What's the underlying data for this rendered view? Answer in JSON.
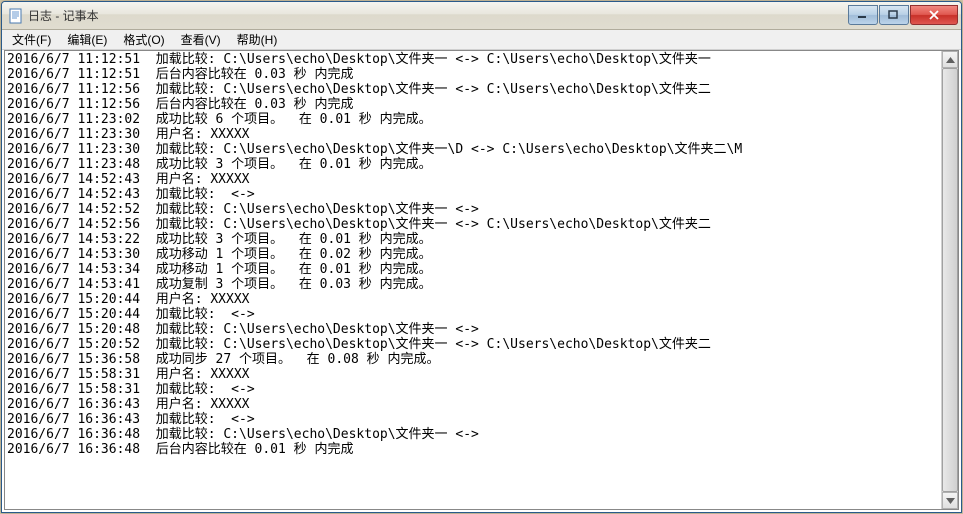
{
  "window": {
    "title": "日志 - 记事本"
  },
  "menu": {
    "file": "文件(F)",
    "edit": "编辑(E)",
    "format": "格式(O)",
    "view": "查看(V)",
    "help": "帮助(H)"
  },
  "log_lines": [
    "2016/6/7 11:12:51  加载比较: C:\\Users\\echo\\Desktop\\文件夹一 <-> C:\\Users\\echo\\Desktop\\文件夹一",
    "2016/6/7 11:12:51  后台内容比较在 0.03 秒 内完成",
    "2016/6/7 11:12:56  加载比较: C:\\Users\\echo\\Desktop\\文件夹一 <-> C:\\Users\\echo\\Desktop\\文件夹二",
    "2016/6/7 11:12:56  后台内容比较在 0.03 秒 内完成",
    "2016/6/7 11:23:02  成功比较 6 个项目。  在 0.01 秒 内完成。",
    "2016/6/7 11:23:30  用户名: XXXXX",
    "2016/6/7 11:23:30  加载比较: C:\\Users\\echo\\Desktop\\文件夹一\\D <-> C:\\Users\\echo\\Desktop\\文件夹二\\M",
    "2016/6/7 11:23:48  成功比较 3 个项目。  在 0.01 秒 内完成。",
    "2016/6/7 14:52:43  用户名: XXXXX",
    "2016/6/7 14:52:43  加载比较:  <->",
    "2016/6/7 14:52:52  加载比较: C:\\Users\\echo\\Desktop\\文件夹一 <->",
    "2016/6/7 14:52:56  加载比较: C:\\Users\\echo\\Desktop\\文件夹一 <-> C:\\Users\\echo\\Desktop\\文件夹二",
    "2016/6/7 14:53:22  成功比较 3 个项目。  在 0.01 秒 内完成。",
    "2016/6/7 14:53:30  成功移动 1 个项目。  在 0.02 秒 内完成。",
    "2016/6/7 14:53:34  成功移动 1 个项目。  在 0.01 秒 内完成。",
    "2016/6/7 14:53:41  成功复制 3 个项目。  在 0.03 秒 内完成。",
    "2016/6/7 15:20:44  用户名: XXXXX",
    "2016/6/7 15:20:44  加载比较:  <->",
    "2016/6/7 15:20:48  加载比较: C:\\Users\\echo\\Desktop\\文件夹一 <->",
    "2016/6/7 15:20:52  加载比较: C:\\Users\\echo\\Desktop\\文件夹一 <-> C:\\Users\\echo\\Desktop\\文件夹二",
    "2016/6/7 15:36:58  成功同步 27 个项目。  在 0.08 秒 内完成。",
    "2016/6/7 15:58:31  用户名: XXXXX",
    "2016/6/7 15:58:31  加载比较:  <->",
    "2016/6/7 16:36:43  用户名: XXXXX",
    "2016/6/7 16:36:43  加载比较:  <->",
    "2016/6/7 16:36:48  加载比较: C:\\Users\\echo\\Desktop\\文件夹一 <->",
    "2016/6/7 16:36:48  后台内容比较在 0.01 秒 内完成"
  ]
}
